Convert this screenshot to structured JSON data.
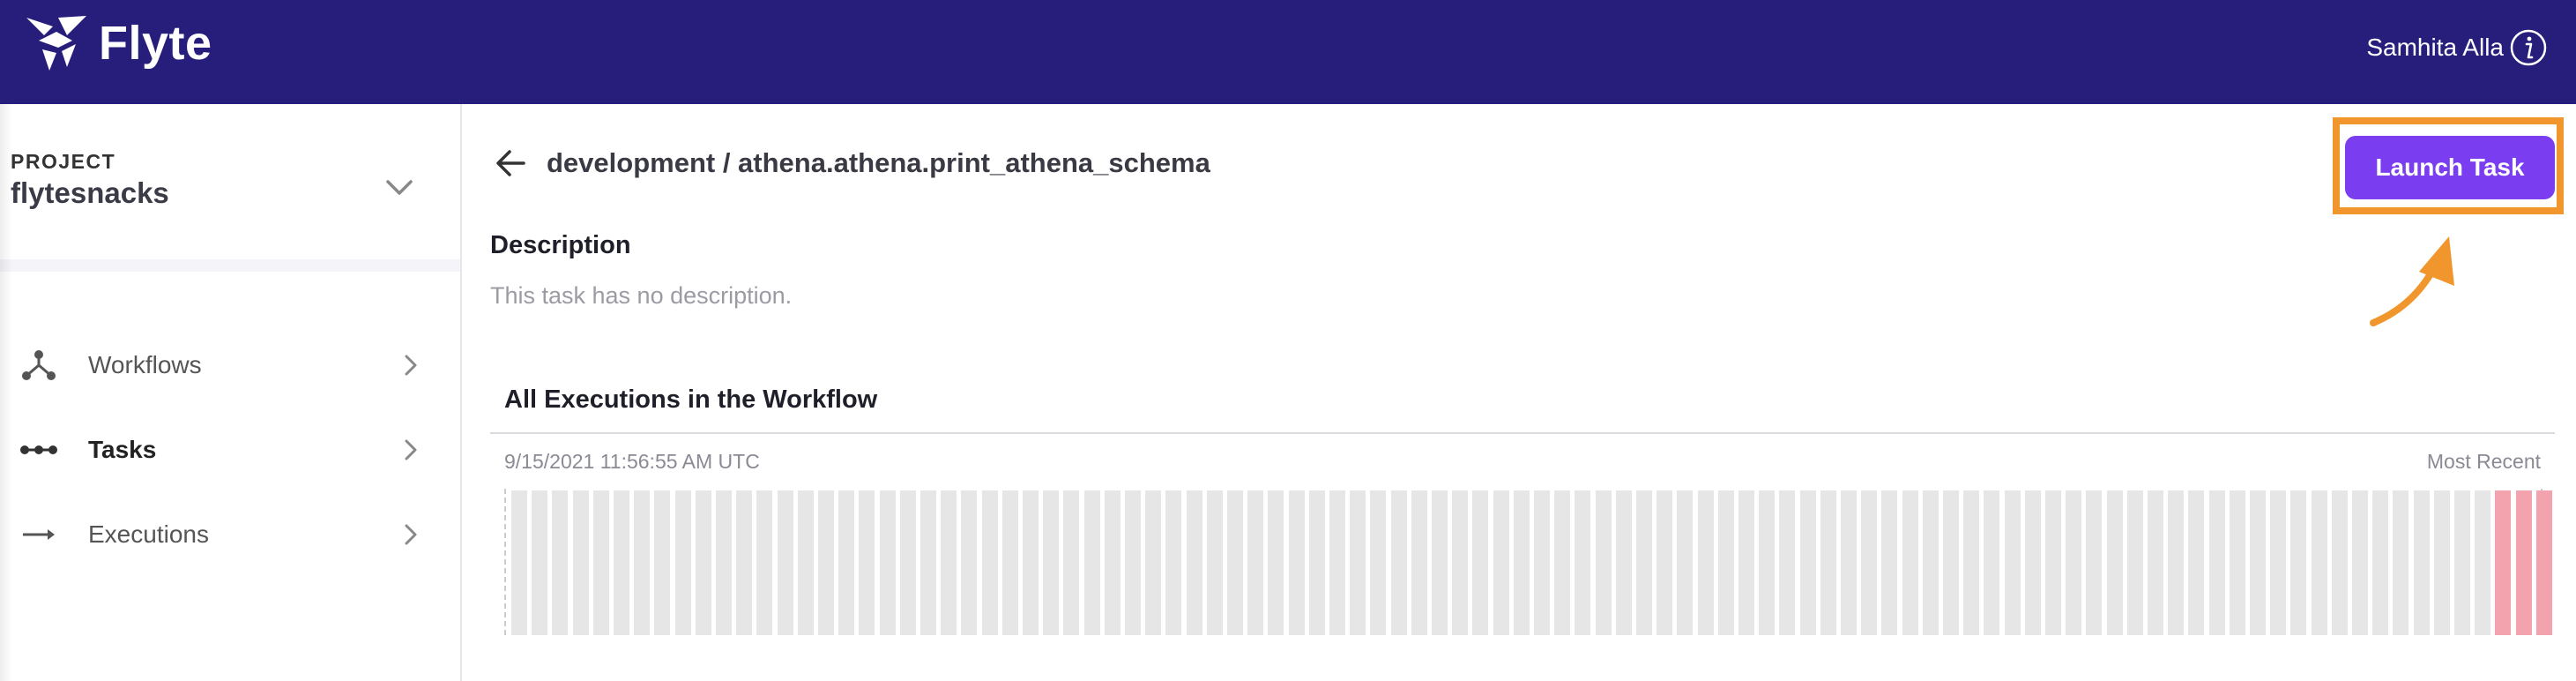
{
  "header": {
    "brand": "Flyte",
    "user_name": "Samhita Alla"
  },
  "sidebar": {
    "project_label": "PROJECT",
    "project_name": "flytesnacks",
    "items": [
      {
        "label": "Workflows",
        "icon": "workflows-icon"
      },
      {
        "label": "Tasks",
        "icon": "tasks-icon",
        "active": true
      },
      {
        "label": "Executions",
        "icon": "executions-icon"
      }
    ]
  },
  "main": {
    "breadcrumb": "development / athena.athena.print_athena_schema",
    "launch_button": "Launch Task",
    "description_heading": "Description",
    "description_text": "This task has no description.",
    "executions_heading": "All Executions in the Workflow",
    "timeline_start": "9/15/2021 11:56:55 AM UTC",
    "timeline_end": "Most Recent",
    "execution_bars": {
      "total": 100,
      "statuses": [
        "none",
        "none",
        "none",
        "none",
        "none",
        "none",
        "none",
        "none",
        "none",
        "none",
        "none",
        "none",
        "none",
        "none",
        "none",
        "none",
        "none",
        "none",
        "none",
        "none",
        "none",
        "none",
        "none",
        "none",
        "none",
        "none",
        "none",
        "none",
        "none",
        "none",
        "none",
        "none",
        "none",
        "none",
        "none",
        "none",
        "none",
        "none",
        "none",
        "none",
        "none",
        "none",
        "none",
        "none",
        "none",
        "none",
        "none",
        "none",
        "none",
        "none",
        "none",
        "none",
        "none",
        "none",
        "none",
        "none",
        "none",
        "none",
        "none",
        "none",
        "none",
        "none",
        "none",
        "none",
        "none",
        "none",
        "none",
        "none",
        "none",
        "none",
        "none",
        "none",
        "none",
        "none",
        "none",
        "none",
        "none",
        "none",
        "none",
        "none",
        "none",
        "none",
        "none",
        "none",
        "none",
        "none",
        "none",
        "none",
        "none",
        "none",
        "none",
        "none",
        "none",
        "none",
        "none",
        "none",
        "none",
        "failed",
        "failed",
        "failed"
      ]
    }
  },
  "colors": {
    "header_bg": "#271e7c",
    "accent_purple": "#7b3df0",
    "highlight_orange": "#f0962c",
    "bar_default": "#e6e6e6",
    "bar_failed": "#f3a3ad"
  }
}
